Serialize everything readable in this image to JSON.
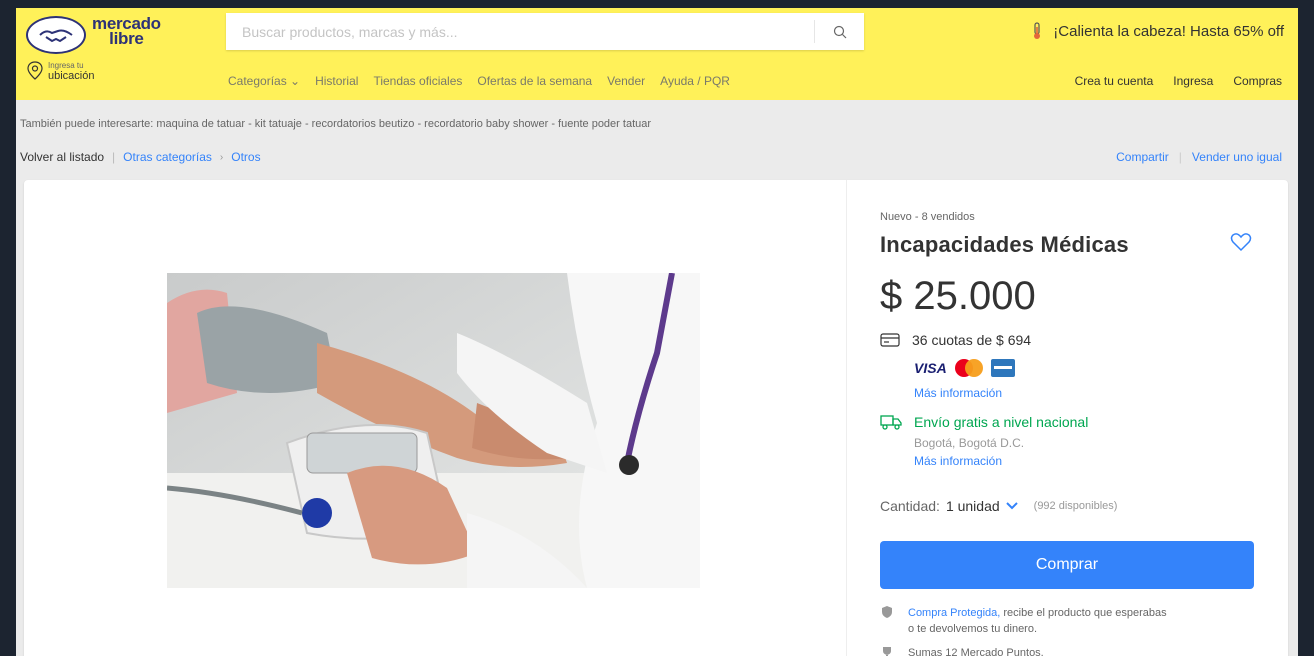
{
  "header": {
    "logo_line1": "mercado",
    "logo_line2": "libre",
    "search_placeholder": "Buscar productos, marcas y más...",
    "promo_text": "¡Calienta la cabeza! Hasta 65% off",
    "location_small": "Ingresa tu",
    "location_main": "ubicación",
    "nav": [
      "Categorías ⌄",
      "Historial",
      "Tiendas oficiales",
      "Ofertas de la semana",
      "Vender",
      "Ayuda / PQR"
    ],
    "account": [
      "Crea tu cuenta",
      "Ingresa",
      "Compras"
    ]
  },
  "suggestions": "También puede interesarte: maquina de tatuar - kit tatuaje - recordatorios beutizo - recordatorio baby shower - fuente poder tatuar",
  "breadcrumb": {
    "back": "Volver al listado",
    "cat1": "Otras categorías",
    "cat2": "Otros",
    "share": "Compartir",
    "sell_same": "Vender uno igual"
  },
  "product": {
    "condition": "Nuevo  -  8 vendidos",
    "title": "Incapacidades Médicas",
    "price": "$ 25.000",
    "installments": "36 cuotas de $ 694",
    "visa": "VISA",
    "more_info": "Más información",
    "shipping": "Envío gratis a nivel nacional",
    "shipping_city": "Bogotá, Bogotá D.C.",
    "quantity_label": "Cantidad:",
    "quantity_value": "1 unidad",
    "available": "(992 disponibles)",
    "buy_label": "Comprar",
    "protected_link": "Compra Protegida,",
    "protected_text": " recibe el producto que esperabas",
    "protected_text2": "o te devolvemos tu dinero.",
    "points": "Sumas 12 Mercado Puntos."
  },
  "colors": {
    "header_bg": "#fff159",
    "accent": "#3483fa",
    "shipping": "#00a650"
  }
}
